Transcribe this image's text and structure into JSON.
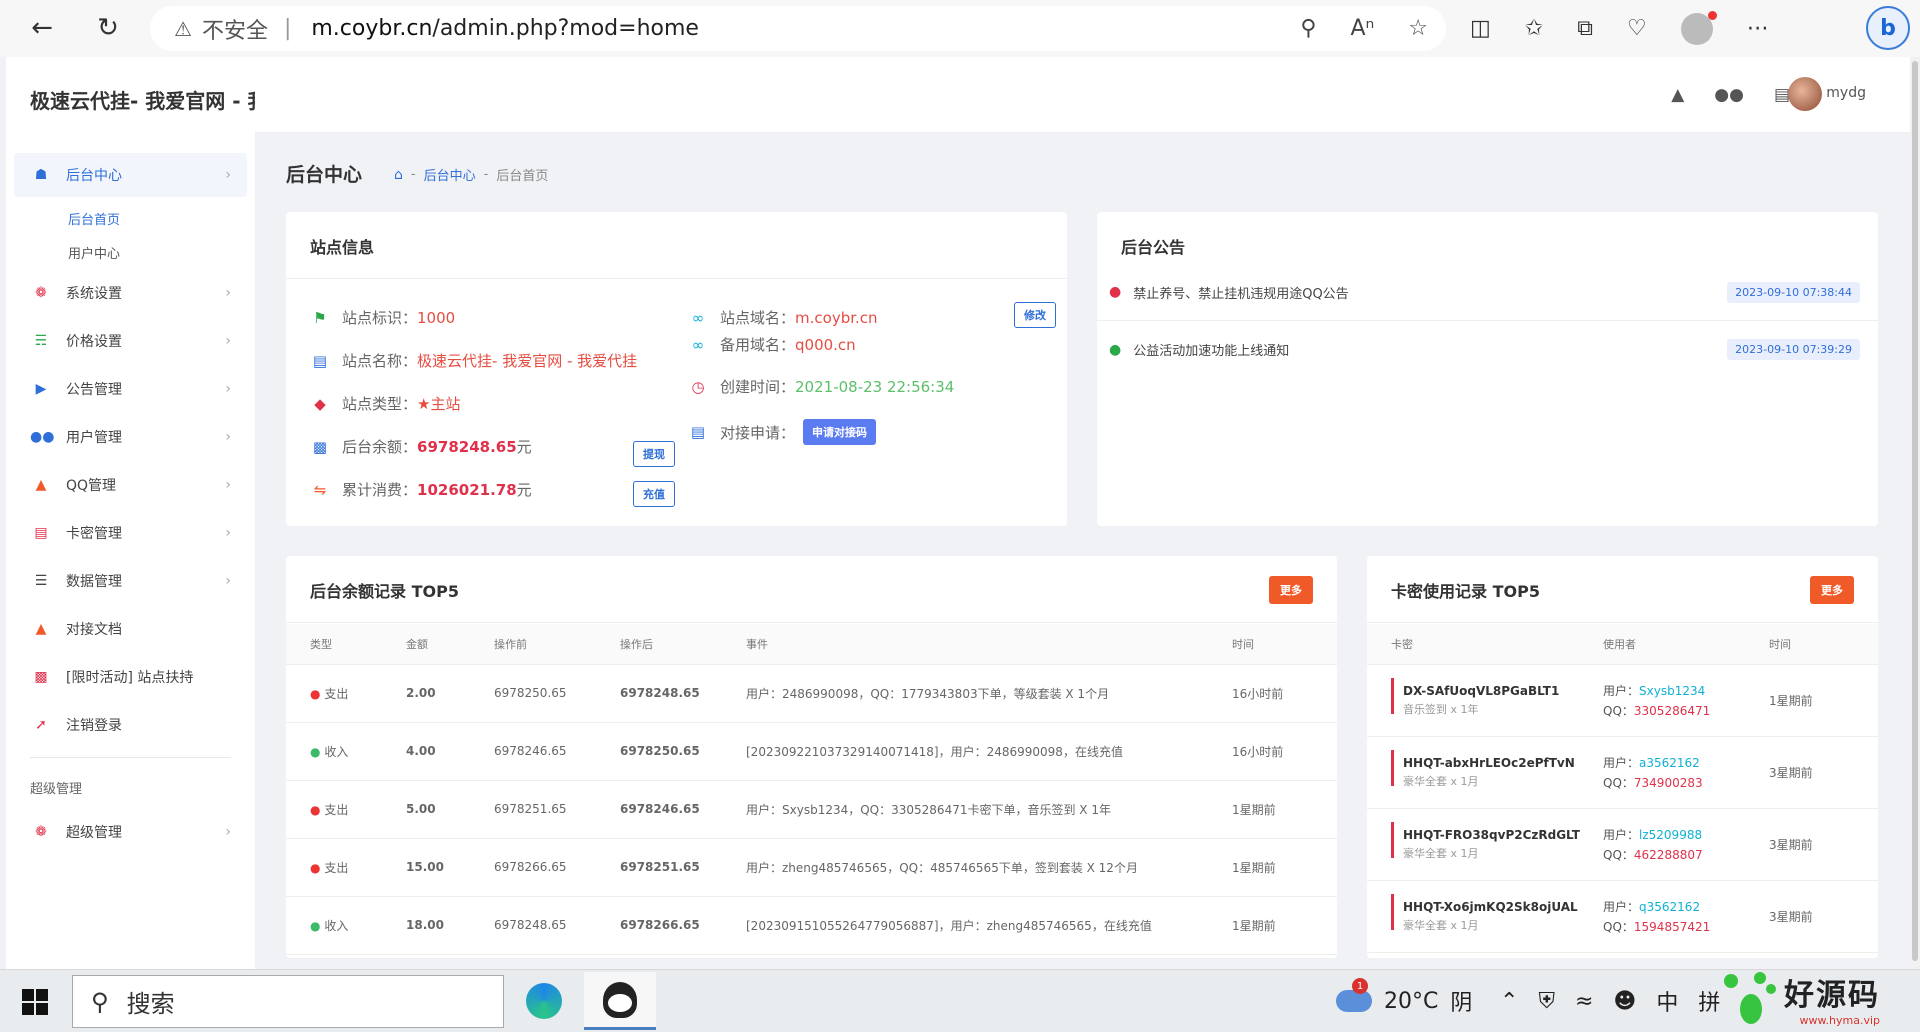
{
  "browser": {
    "insecure_label": "不安全",
    "url_host": "m.coybr.cn",
    "url_path": "/admin.php?mod=home"
  },
  "sidebar": {
    "brand": "极速云代挂- 我爱官网 - 我爱代挂",
    "menu": [
      {
        "label": "后台中心",
        "icon": "store-icon"
      },
      {
        "label": "后台首页"
      },
      {
        "label": "用户中心"
      },
      {
        "label": "系统设置",
        "icon": "gear-icon"
      },
      {
        "label": "价格设置",
        "icon": "cart-icon"
      },
      {
        "label": "公告管理",
        "icon": "megaphone-icon"
      },
      {
        "label": "用户管理",
        "icon": "users-icon"
      },
      {
        "label": "QQ管理",
        "icon": "qq-icon"
      },
      {
        "label": "卡密管理",
        "icon": "card-icon"
      },
      {
        "label": "数据管理",
        "icon": "list-icon"
      },
      {
        "label": "对接文档",
        "icon": "graduation-cap-icon"
      },
      {
        "label": "[限时活动] 站点扶持",
        "icon": "gift-icon"
      },
      {
        "label": "注销登录",
        "icon": "logout-icon"
      }
    ],
    "super_heading": "超级管理",
    "super_item": "超级管理"
  },
  "topbar": {
    "username": "mydg"
  },
  "page": {
    "title": "后台中心",
    "breadcrumb": [
      "后台中心",
      "后台首页"
    ]
  },
  "site_info": {
    "title": "站点信息",
    "id_label": "站点标识：",
    "id_value": "1000",
    "name_label": "站点名称：",
    "name_value": "极速云代挂- 我爱官网 - 我爱代挂",
    "type_label": "站点类型：",
    "type_value": "主站",
    "balance_label": "后台余额：",
    "balance_value": "6978248.65",
    "balance_unit": " 元",
    "spent_label": "累计消费：",
    "spent_value": "1026021.78",
    "spent_unit": " 元",
    "domain_label": "站点域名：",
    "domain_value": "m.coybr.cn",
    "backup_label": "备用域名：",
    "backup_value": "q000.cn",
    "created_label": "创建时间：",
    "created_value": "2021-08-23 22:56:34",
    "dock_label": "对接申请：",
    "dock_button": "申请对接码",
    "edit_button": "修改",
    "withdraw_button": "提现",
    "recharge_button": "充值"
  },
  "notice": {
    "title": "后台公告",
    "items": [
      {
        "text": "禁止养号、禁止挂机违规用途QQ公告",
        "date": "2023-09-10 07:38:44"
      },
      {
        "text": "公益活动加速功能上线通知",
        "date": "2023-09-10 07:39:29"
      }
    ]
  },
  "balance_log": {
    "title": "后台余额记录 TOP5",
    "more": "更多",
    "headers": [
      "类型",
      "金额",
      "操作前",
      "操作后",
      "事件",
      "时间"
    ],
    "rows": [
      {
        "type": "支出",
        "dot": "red",
        "amount": "2.00",
        "before": "6978250.65",
        "after": "6978248.65",
        "event": "用户：2486990098，QQ：1779343803下单，等级套装 X 1个月",
        "time": "16小时前"
      },
      {
        "type": "收入",
        "dot": "green",
        "amount": "4.00",
        "before": "6978246.65",
        "after": "6978250.65",
        "event": "[20230922103732914007141​8]，用户：2486990098，在线充值",
        "time": "16小时前"
      },
      {
        "type": "支出",
        "dot": "red",
        "amount": "5.00",
        "before": "6978251.65",
        "after": "6978246.65",
        "event": "用户：Sxysb1234，QQ：3305286471卡密下单，音乐签到 X 1年",
        "time": "1星期前"
      },
      {
        "type": "支出",
        "dot": "red",
        "amount": "15.00",
        "before": "6978266.65",
        "after": "6978251.65",
        "event": "用户：zheng485746565，QQ：485746565下单，签到套装 X 12个月",
        "time": "1星期前"
      },
      {
        "type": "收入",
        "dot": "green",
        "amount": "18.00",
        "before": "6978248.65",
        "after": "6978266.65",
        "event": "[2023091510552647790568​87]，用户：zheng485746565，在线充值",
        "time": "1星期前"
      }
    ]
  },
  "card_log": {
    "title": "卡密使用记录 TOP5",
    "more": "更多",
    "headers": [
      "卡密",
      "使用者",
      "时间"
    ],
    "user_prefix": "用户：",
    "qq_prefix": "QQ：",
    "rows": [
      {
        "code": "DX-SAfUoqVL8PGaBLT1",
        "desc": "音乐签到 x 1年",
        "user": "Sxysb1234",
        "qq": "3305286471",
        "time": "1星期前"
      },
      {
        "code": "HHQT-abxHrLEOc2ePfTvN",
        "desc": "豪华全套 x 1月",
        "user": "a3562162",
        "qq": "734900283",
        "time": "3星期前"
      },
      {
        "code": "HHQT-FRO38qvP2CzRdGLT",
        "desc": "豪华全套 x 1月",
        "user": "lz5209988",
        "qq": "462288807",
        "time": "3星期前"
      },
      {
        "code": "HHQT-Xo6jmKQ2Sk8ojUAL",
        "desc": "豪华全套 x 1月",
        "user": "q3562162",
        "qq": "1594857421",
        "time": "3星期前"
      }
    ]
  },
  "taskbar": {
    "search_placeholder": "搜索",
    "weather_badge": "1",
    "temperature": "20°C",
    "weather": "阴",
    "ime": "中",
    "ime2": "拼"
  },
  "watermark": {
    "text": "好源码",
    "site": "www.hyma.vip"
  }
}
